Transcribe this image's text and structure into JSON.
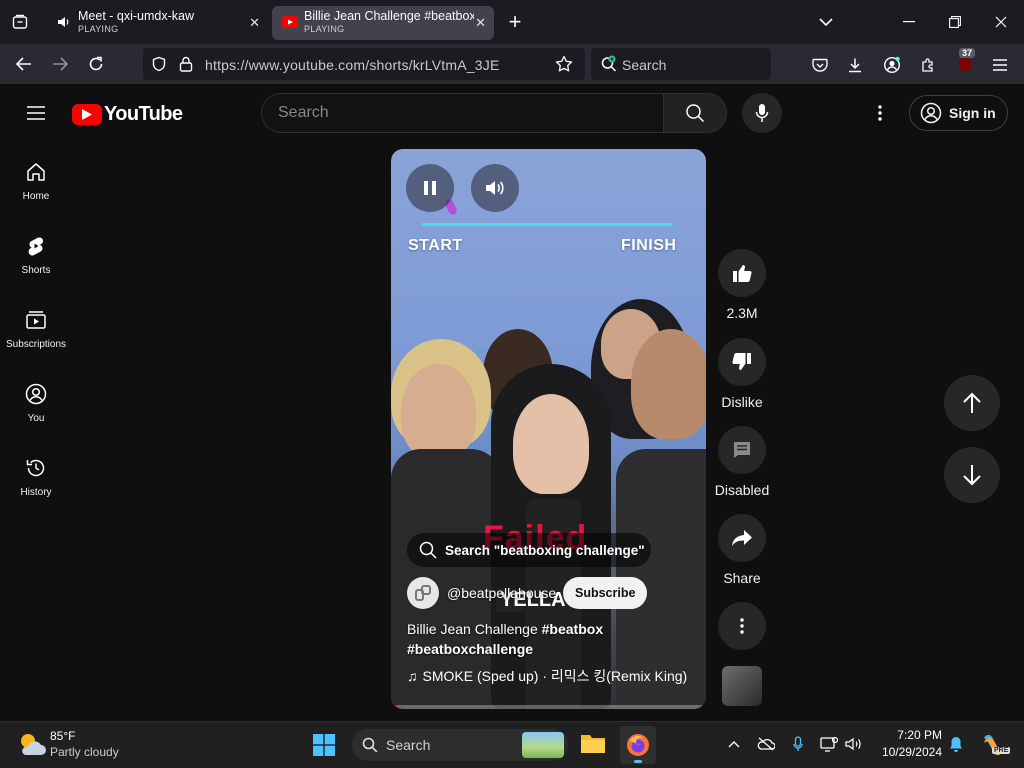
{
  "browser": {
    "tabs": [
      {
        "title": "Meet - qxi-umdx-kaw",
        "status": "PLAYING"
      },
      {
        "title": "Billie Jean Challenge #beatbox #",
        "status": "PLAYING"
      }
    ],
    "url": "https://www.youtube.com/shorts/krLVtmA_3JE",
    "search_placeholder": "Search",
    "extensions_badge": "37"
  },
  "youtube": {
    "logo_text": "YouTube",
    "search_placeholder": "Search",
    "sign_in": "Sign in",
    "sidebar": [
      {
        "label": "Home"
      },
      {
        "label": "Shorts"
      },
      {
        "label": "Subscriptions"
      },
      {
        "label": "You"
      },
      {
        "label": "History"
      }
    ],
    "short": {
      "overlay_start": "START",
      "overlay_finish": "FINISH",
      "overlay_caption": "Failed",
      "overlay_sign": "YELLA",
      "search_suggestion": "Search \"beatboxing challenge\"",
      "channel": "@beatpellahouse",
      "subscribe": "Subscribe",
      "title_plain": "Billie Jean Challenge ",
      "title_tag1": "#beatbox",
      "title_tag2": "#beatboxchallenge",
      "music": "SMOKE (Sped up) · 리믹스 킹(Remix King)",
      "progress": 0.02
    },
    "actions": {
      "likes": "2.3M",
      "dislike": "Dislike",
      "comments": "Disabled",
      "share": "Share"
    }
  },
  "taskbar": {
    "weather_temp": "85°F",
    "weather_desc": "Partly cloudy",
    "search_placeholder": "Search",
    "time": "7:20 PM",
    "date": "10/29/2024"
  }
}
